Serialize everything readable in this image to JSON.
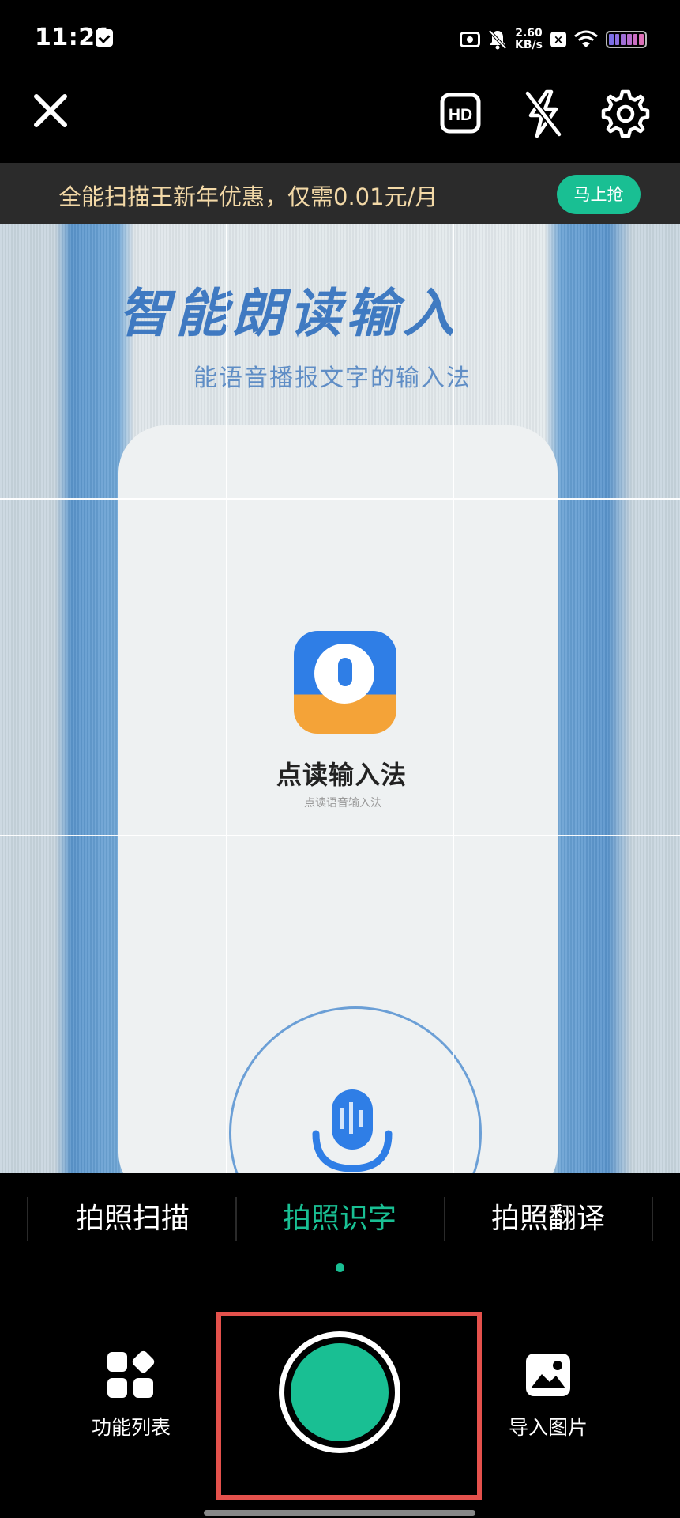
{
  "status_bar": {
    "time": "11:21",
    "net_speed_value": "2.60",
    "net_speed_unit": "KB/s",
    "icons": [
      "message-icon",
      "camera-icon",
      "mute-icon",
      "x-box-icon",
      "wifi-icon",
      "battery-icon"
    ]
  },
  "toolbar": {
    "close_icon": "close-icon",
    "hd_label": "HD",
    "flash_icon": "flash-off-icon",
    "settings_icon": "gear-icon"
  },
  "promo": {
    "text": "全能扫描王新年优惠，仅需0.01元/月",
    "button_label": "马上抢",
    "text_color": "#f3d9a7",
    "button_color": "#19bf93"
  },
  "viewfinder": {
    "heading": "智能朗读输入",
    "subheading": "能语音播报文字的输入法",
    "app_label": "点读输入法",
    "app_tagline": "点读语音输入法"
  },
  "modes": {
    "tabs": [
      {
        "label": "拍照扫描",
        "active": false
      },
      {
        "label": "拍照识字",
        "active": true
      },
      {
        "label": "拍照翻译",
        "active": false
      }
    ],
    "active_color": "#19bf93"
  },
  "bottom": {
    "function_list_label": "功能列表",
    "import_image_label": "导入图片",
    "shutter_color": "#19bf93",
    "highlight_color": "#e4514c"
  }
}
